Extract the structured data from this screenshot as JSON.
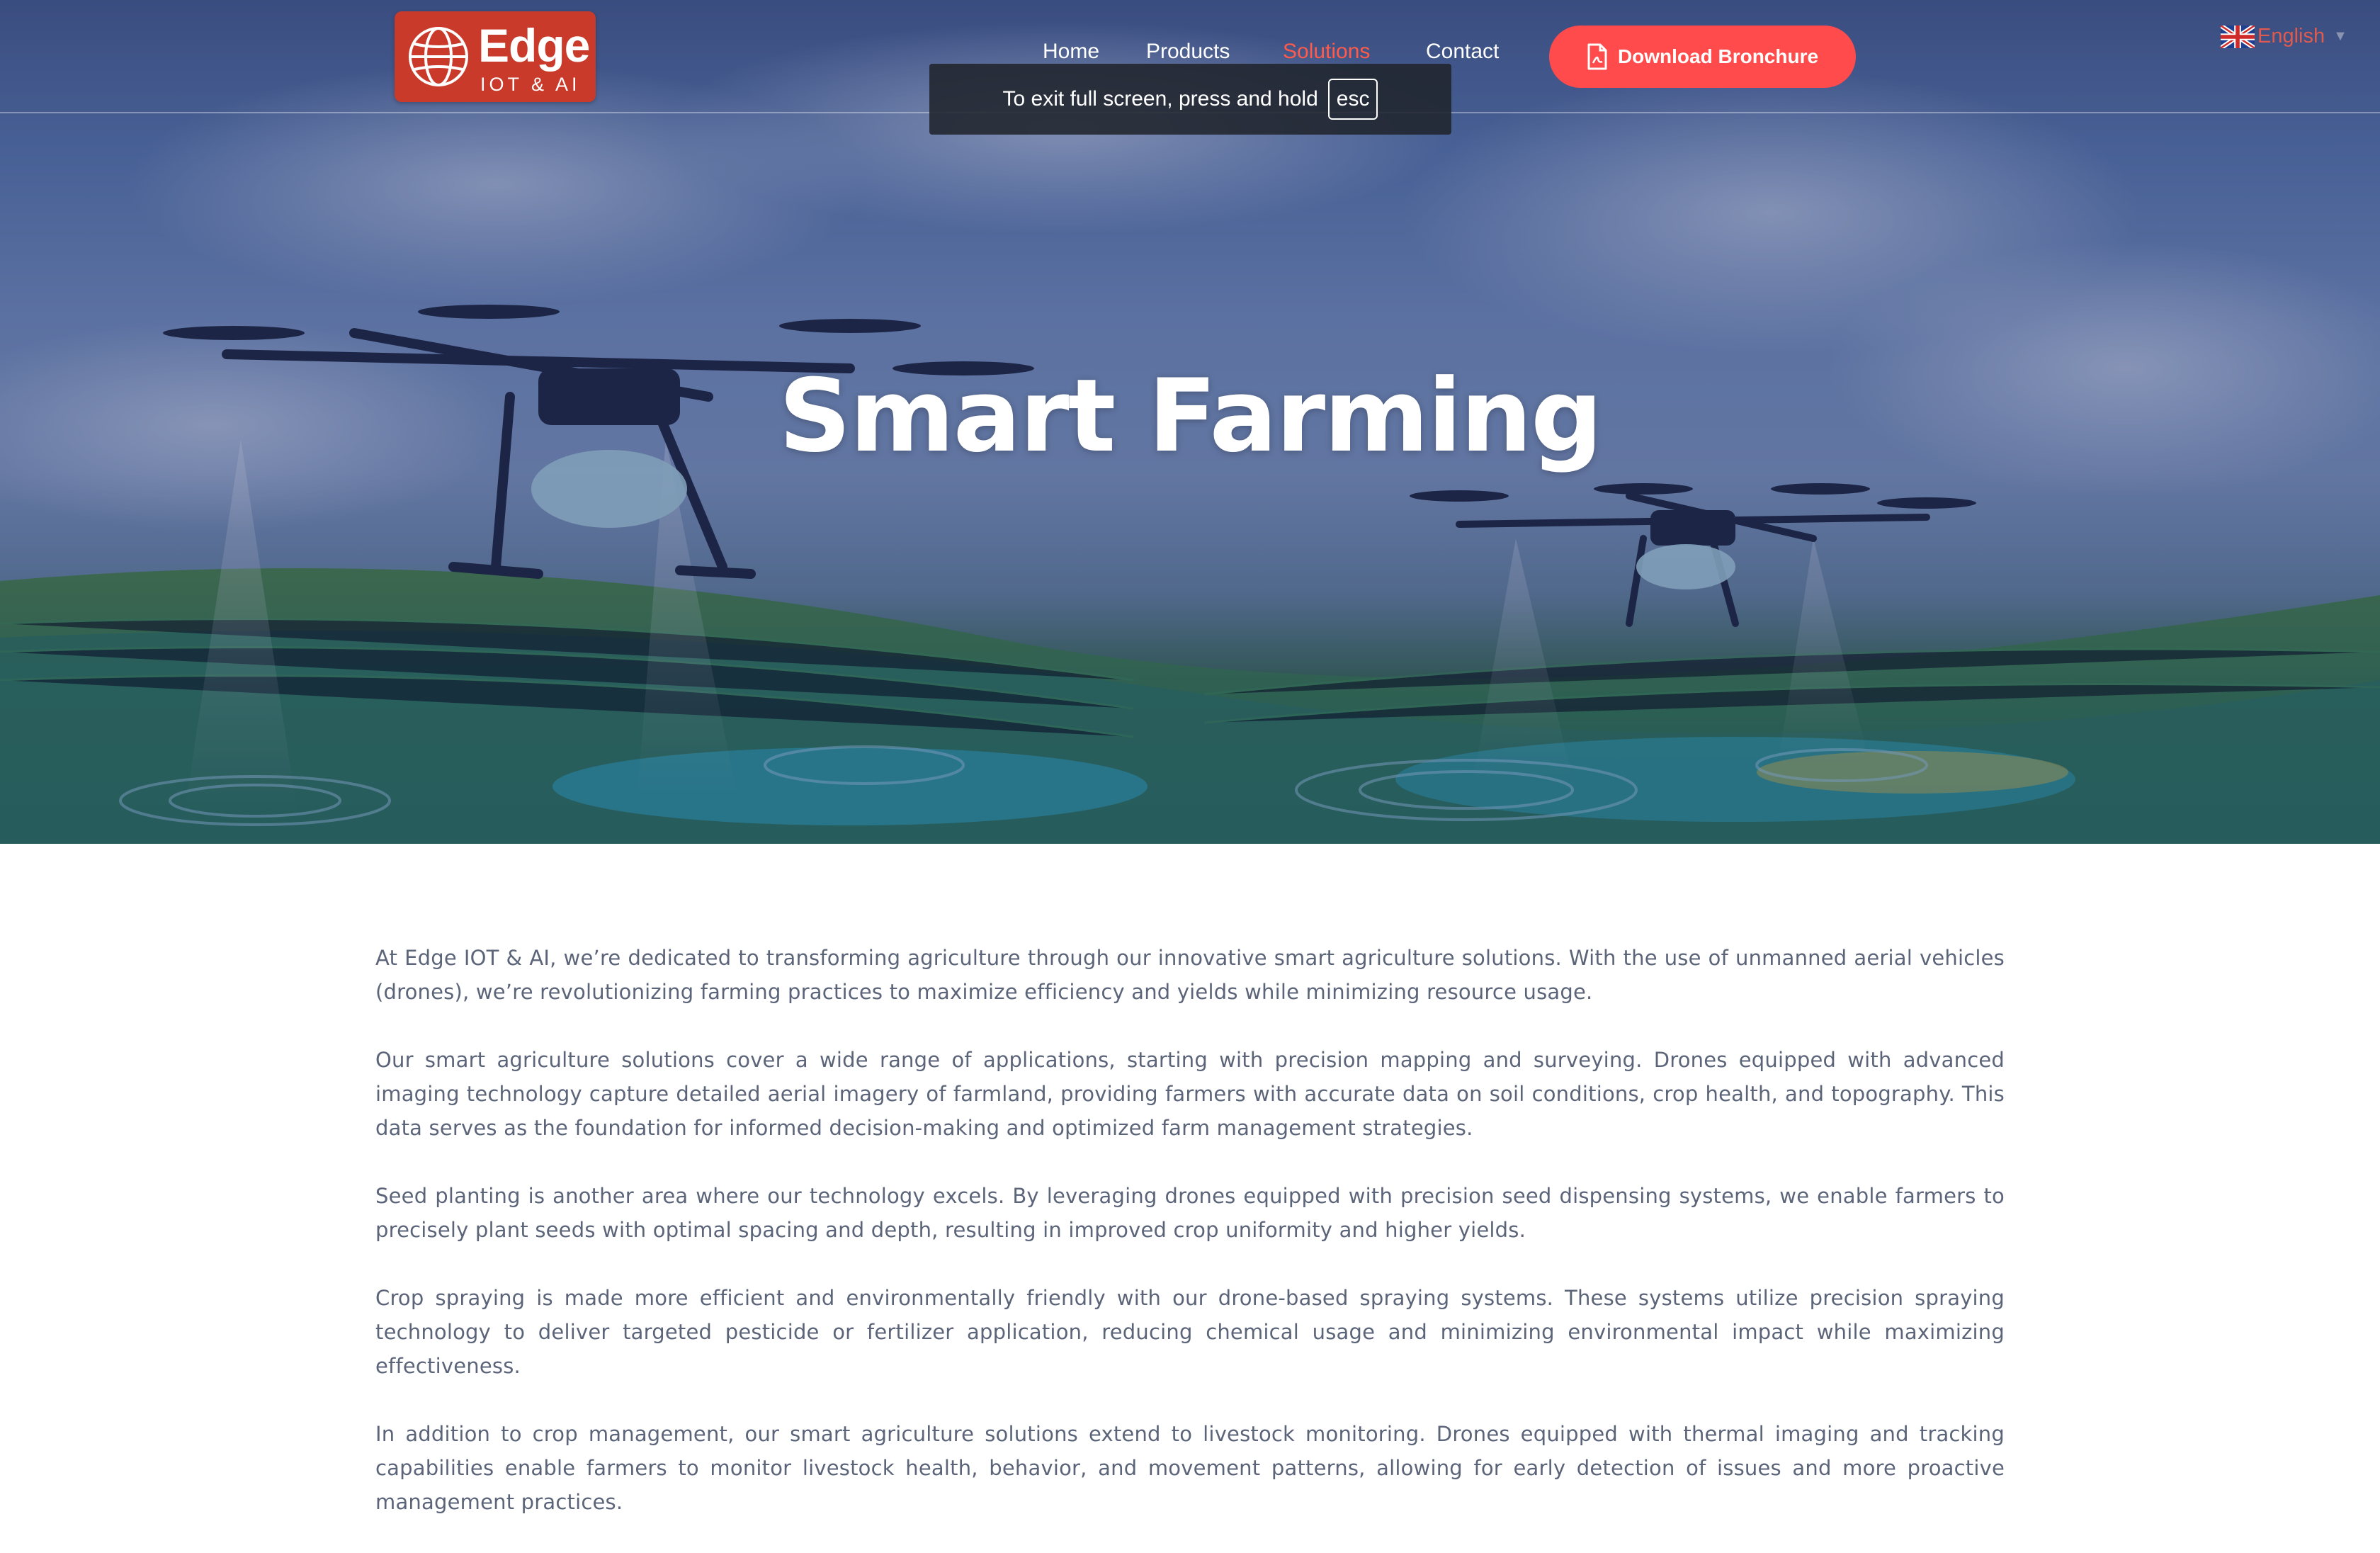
{
  "header": {
    "logo": {
      "brand": "Edge",
      "tagline": "IOT & AI"
    },
    "nav": [
      {
        "label": "Home",
        "active": false
      },
      {
        "label": "Products",
        "active": false
      },
      {
        "label": "Solutions",
        "active": true
      },
      {
        "label": "Contact",
        "active": false
      }
    ],
    "download_button": "Download Bronchure",
    "language": "English"
  },
  "toast": {
    "text": "To exit full screen, press and hold",
    "key": "esc"
  },
  "hero": {
    "title": "Smart Farming"
  },
  "content": {
    "paragraphs": [
      "At Edge IOT & AI, we’re dedicated to transforming agriculture through our innovative smart agriculture solutions. With the use of unmanned aerial vehicles (drones), we’re revolutionizing farming practices to maximize efficiency and yields while minimizing resource usage.",
      "Our smart agriculture solutions cover a wide range of applications, starting with precision mapping and surveying. Drones equipped with advanced imaging technology capture detailed aerial imagery of farmland, providing farmers with accurate data on soil conditions, crop health, and topography. This data serves as the foundation for informed decision-making and optimized farm management strategies.",
      "Seed planting is another area where our technology excels. By leveraging drones equipped with precision seed dispensing systems, we enable farmers to precisely plant seeds with optimal spacing and depth, resulting in improved crop uniformity and higher yields.",
      "Crop spraying is made more efficient and environmentally friendly with our drone-based spraying systems. These systems utilize precision spraying technology to deliver targeted pesticide or fertilizer application, reducing chemical usage and minimizing environmental impact while maximizing effectiveness.",
      "In addition to crop management, our smart agriculture solutions extend to livestock monitoring. Drones equipped with thermal imaging and tracking capabilities enable farmers to monitor livestock health, behavior, and movement patterns, allowing for early detection of issues and more proactive management practices."
    ]
  },
  "colors": {
    "accent": "#ff4b4b",
    "logo_bg": "#c93a2a",
    "active_nav": "#ff5a4a",
    "body_text": "#5b6478"
  },
  "icons": [
    "globe-icon",
    "pdf-icon",
    "uk-flag-icon",
    "caret-down-icon"
  ]
}
